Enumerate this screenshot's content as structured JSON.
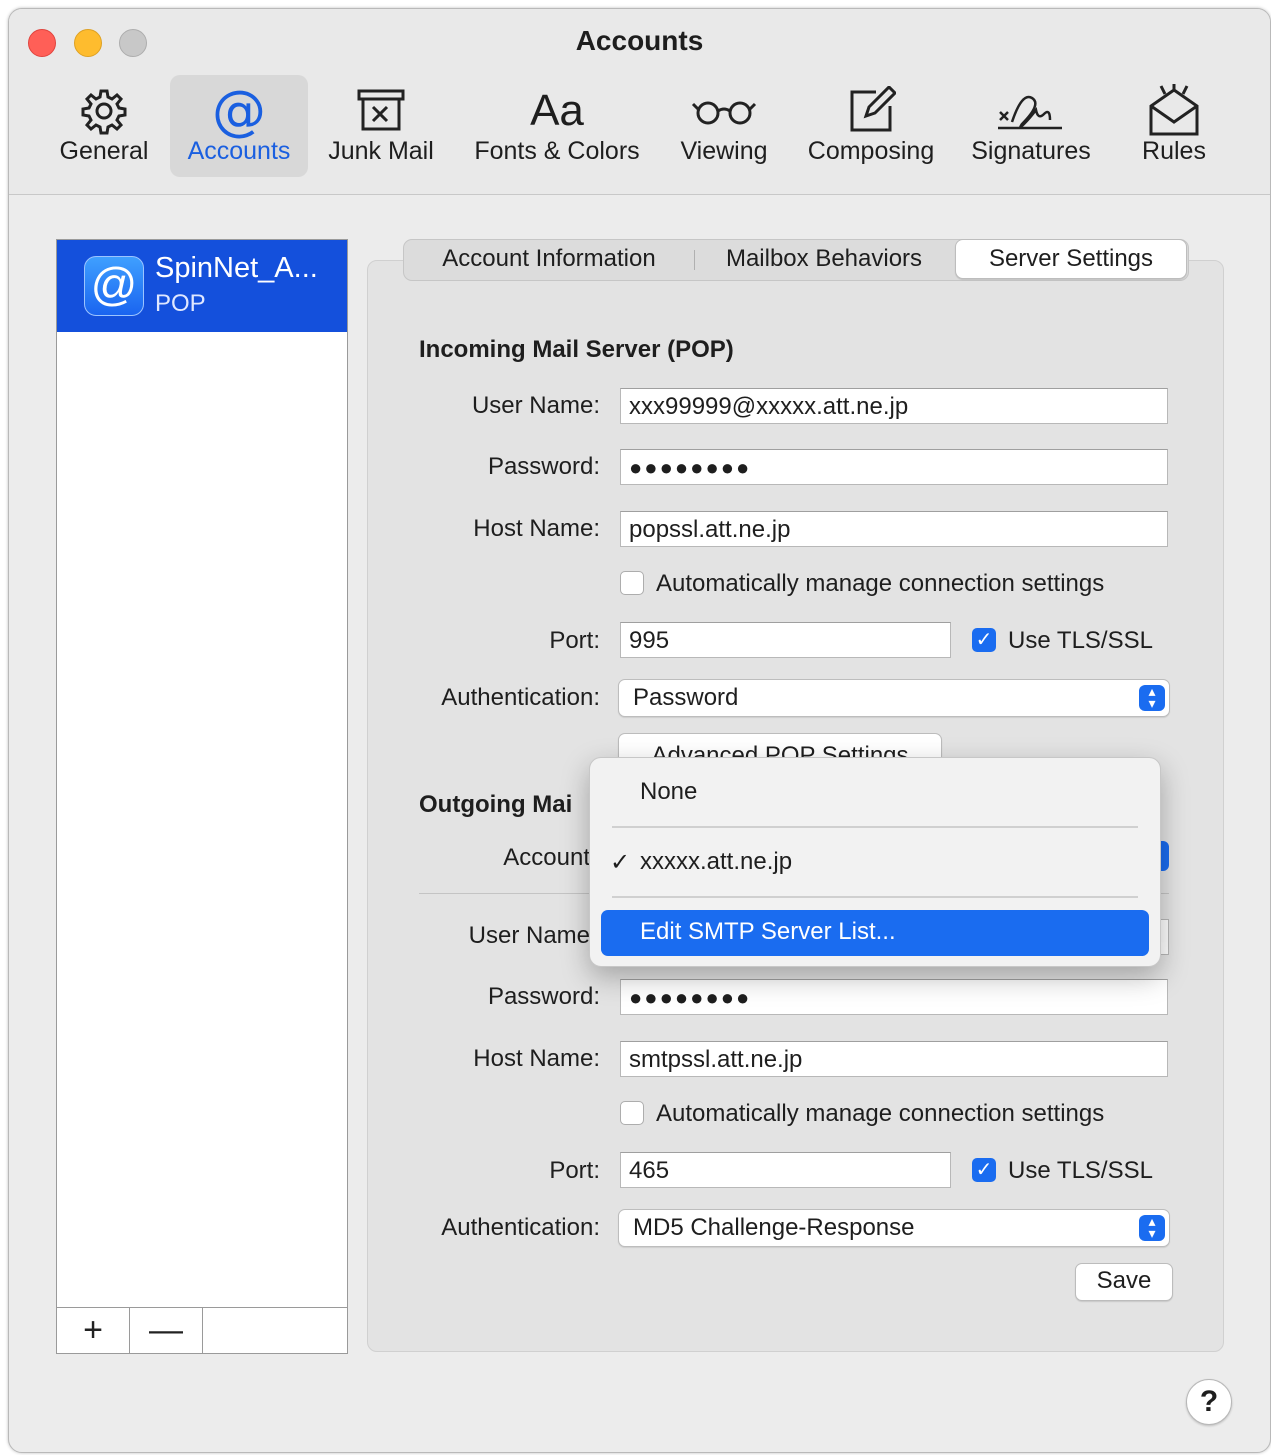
{
  "window": {
    "title": "Accounts"
  },
  "toolbar": {
    "items": [
      {
        "label": "General",
        "icon": "gear-icon"
      },
      {
        "label": "Accounts",
        "icon": "at-sign-icon"
      },
      {
        "label": "Junk Mail",
        "icon": "junk-mail-icon"
      },
      {
        "label": "Fonts & Colors",
        "icon": "fonts-icon"
      },
      {
        "label": "Viewing",
        "icon": "glasses-icon"
      },
      {
        "label": "Composing",
        "icon": "compose-icon"
      },
      {
        "label": "Signatures",
        "icon": "signature-icon"
      },
      {
        "label": "Rules",
        "icon": "rules-icon"
      }
    ],
    "active": "Accounts",
    "fonts_glyph": "Aa",
    "at_glyph": "@"
  },
  "sidebar": {
    "account": {
      "name": "SpinNet_A...",
      "type": "POP",
      "icon_glyph": "@"
    },
    "add_label": "+",
    "remove_label": "—"
  },
  "tabs": {
    "items": [
      "Account Information",
      "Mailbox Behaviors",
      "Server Settings"
    ],
    "selected": "Server Settings"
  },
  "incoming": {
    "title": "Incoming Mail Server (POP)",
    "user_label": "User Name:",
    "user_value": "xxx99999@xxxxx.att.ne.jp",
    "password_label": "Password:",
    "password_value": "●●●●●●●●",
    "host_label": "Host Name:",
    "host_value": "popssl.att.ne.jp",
    "auto_label": "Automatically manage connection settings",
    "port_label": "Port:",
    "port_value": "995",
    "tls_label": "Use TLS/SSL",
    "auth_label": "Authentication:",
    "auth_value": "Password",
    "advanced_button": "Advanced POP Settings"
  },
  "outgoing": {
    "title": "Outgoing Mai",
    "account_label": "Account",
    "user_label": "User Name",
    "password_label": "Password:",
    "password_value": "●●●●●●●●",
    "host_label": "Host Name:",
    "host_value": "smtpssl.att.ne.jp",
    "auto_label": "Automatically manage connection settings",
    "port_label": "Port:",
    "port_value": "465",
    "tls_label": "Use TLS/SSL",
    "auth_label": "Authentication:",
    "auth_value": "MD5 Challenge-Response"
  },
  "smtp_menu": {
    "items": [
      "None",
      "xxxxx.att.ne.jp",
      "Edit SMTP Server List..."
    ],
    "checked": "xxxxx.att.ne.jp",
    "check_glyph": "✓",
    "highlighted": "Edit SMTP Server List..."
  },
  "buttons": {
    "save": "Save",
    "help": "?"
  },
  "colors": {
    "accent": "#1a6cf0",
    "sidebar_selection": "#1450dc"
  }
}
